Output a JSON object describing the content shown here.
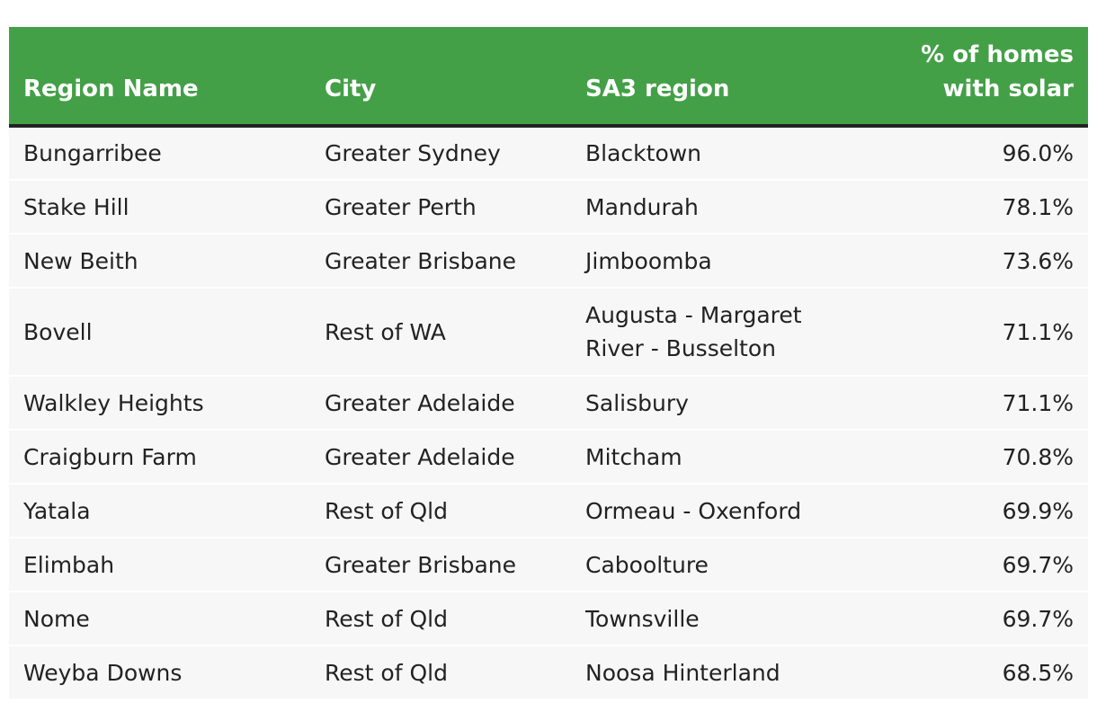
{
  "chart_data": {
    "type": "table",
    "columns": [
      "Region Name",
      "City",
      "SA3 region",
      "% of homes with solar"
    ],
    "header_lines": {
      "value_column": [
        "% of homes",
        "with solar"
      ]
    },
    "rows": [
      {
        "region": "Bungarribee",
        "city": "Greater Sydney",
        "sa3": "Blacktown",
        "solar": "96.0%"
      },
      {
        "region": "Stake Hill",
        "city": "Greater Perth",
        "sa3": "Mandurah",
        "solar": "78.1%"
      },
      {
        "region": "New Beith",
        "city": "Greater Brisbane",
        "sa3": "Jimboomba",
        "solar": "73.6%"
      },
      {
        "region": "Bovell",
        "city": "Rest of WA",
        "sa3": "Augusta - Margaret River - Busselton",
        "solar": "71.1%"
      },
      {
        "region": "Walkley Heights",
        "city": "Greater Adelaide",
        "sa3": "Salisbury",
        "solar": "71.1%"
      },
      {
        "region": "Craigburn Farm",
        "city": "Greater Adelaide",
        "sa3": "Mitcham",
        "solar": "70.8%"
      },
      {
        "region": "Yatala",
        "city": "Rest of Qld",
        "sa3": "Ormeau - Oxenford",
        "solar": "69.9%"
      },
      {
        "region": "Elimbah",
        "city": "Greater Brisbane",
        "sa3": "Caboolture",
        "solar": "69.7%"
      },
      {
        "region": "Nome",
        "city": "Rest of Qld",
        "sa3": "Townsville",
        "solar": "69.7%"
      },
      {
        "region": "Weyba Downs",
        "city": "Rest of Qld",
        "sa3": "Noosa Hinterland",
        "solar": "68.5%"
      }
    ]
  },
  "colors": {
    "header_bg": "#43a047",
    "header_text": "#ffffff",
    "row_bg": "#f7f7f7",
    "header_rule": "#222222"
  }
}
